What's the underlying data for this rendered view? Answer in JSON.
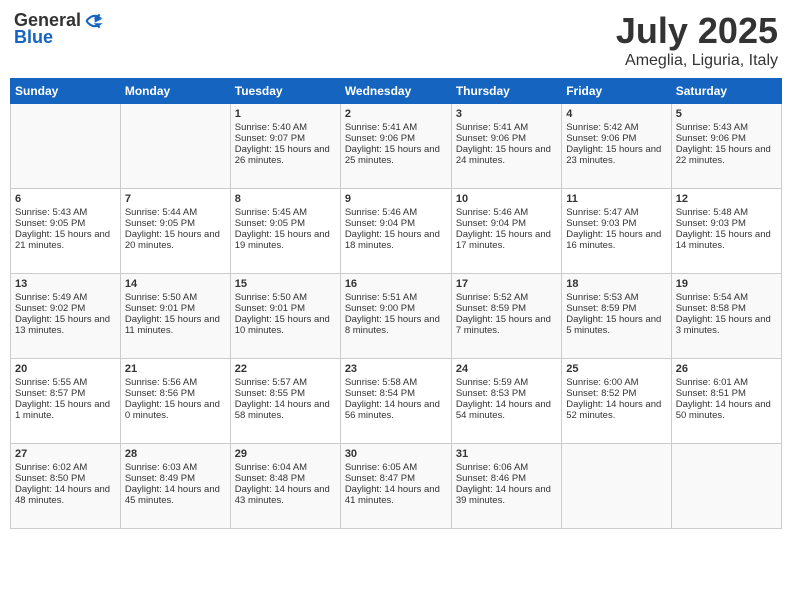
{
  "logo": {
    "general": "General",
    "blue": "Blue"
  },
  "header": {
    "month": "July 2025",
    "location": "Ameglia, Liguria, Italy"
  },
  "weekdays": [
    "Sunday",
    "Monday",
    "Tuesday",
    "Wednesday",
    "Thursday",
    "Friday",
    "Saturday"
  ],
  "weeks": [
    [
      {
        "day": "",
        "sunrise": "",
        "sunset": "",
        "daylight": ""
      },
      {
        "day": "",
        "sunrise": "",
        "sunset": "",
        "daylight": ""
      },
      {
        "day": "1",
        "sunrise": "Sunrise: 5:40 AM",
        "sunset": "Sunset: 9:07 PM",
        "daylight": "Daylight: 15 hours and 26 minutes."
      },
      {
        "day": "2",
        "sunrise": "Sunrise: 5:41 AM",
        "sunset": "Sunset: 9:06 PM",
        "daylight": "Daylight: 15 hours and 25 minutes."
      },
      {
        "day": "3",
        "sunrise": "Sunrise: 5:41 AM",
        "sunset": "Sunset: 9:06 PM",
        "daylight": "Daylight: 15 hours and 24 minutes."
      },
      {
        "day": "4",
        "sunrise": "Sunrise: 5:42 AM",
        "sunset": "Sunset: 9:06 PM",
        "daylight": "Daylight: 15 hours and 23 minutes."
      },
      {
        "day": "5",
        "sunrise": "Sunrise: 5:43 AM",
        "sunset": "Sunset: 9:06 PM",
        "daylight": "Daylight: 15 hours and 22 minutes."
      }
    ],
    [
      {
        "day": "6",
        "sunrise": "Sunrise: 5:43 AM",
        "sunset": "Sunset: 9:05 PM",
        "daylight": "Daylight: 15 hours and 21 minutes."
      },
      {
        "day": "7",
        "sunrise": "Sunrise: 5:44 AM",
        "sunset": "Sunset: 9:05 PM",
        "daylight": "Daylight: 15 hours and 20 minutes."
      },
      {
        "day": "8",
        "sunrise": "Sunrise: 5:45 AM",
        "sunset": "Sunset: 9:05 PM",
        "daylight": "Daylight: 15 hours and 19 minutes."
      },
      {
        "day": "9",
        "sunrise": "Sunrise: 5:46 AM",
        "sunset": "Sunset: 9:04 PM",
        "daylight": "Daylight: 15 hours and 18 minutes."
      },
      {
        "day": "10",
        "sunrise": "Sunrise: 5:46 AM",
        "sunset": "Sunset: 9:04 PM",
        "daylight": "Daylight: 15 hours and 17 minutes."
      },
      {
        "day": "11",
        "sunrise": "Sunrise: 5:47 AM",
        "sunset": "Sunset: 9:03 PM",
        "daylight": "Daylight: 15 hours and 16 minutes."
      },
      {
        "day": "12",
        "sunrise": "Sunrise: 5:48 AM",
        "sunset": "Sunset: 9:03 PM",
        "daylight": "Daylight: 15 hours and 14 minutes."
      }
    ],
    [
      {
        "day": "13",
        "sunrise": "Sunrise: 5:49 AM",
        "sunset": "Sunset: 9:02 PM",
        "daylight": "Daylight: 15 hours and 13 minutes."
      },
      {
        "day": "14",
        "sunrise": "Sunrise: 5:50 AM",
        "sunset": "Sunset: 9:01 PM",
        "daylight": "Daylight: 15 hours and 11 minutes."
      },
      {
        "day": "15",
        "sunrise": "Sunrise: 5:50 AM",
        "sunset": "Sunset: 9:01 PM",
        "daylight": "Daylight: 15 hours and 10 minutes."
      },
      {
        "day": "16",
        "sunrise": "Sunrise: 5:51 AM",
        "sunset": "Sunset: 9:00 PM",
        "daylight": "Daylight: 15 hours and 8 minutes."
      },
      {
        "day": "17",
        "sunrise": "Sunrise: 5:52 AM",
        "sunset": "Sunset: 8:59 PM",
        "daylight": "Daylight: 15 hours and 7 minutes."
      },
      {
        "day": "18",
        "sunrise": "Sunrise: 5:53 AM",
        "sunset": "Sunset: 8:59 PM",
        "daylight": "Daylight: 15 hours and 5 minutes."
      },
      {
        "day": "19",
        "sunrise": "Sunrise: 5:54 AM",
        "sunset": "Sunset: 8:58 PM",
        "daylight": "Daylight: 15 hours and 3 minutes."
      }
    ],
    [
      {
        "day": "20",
        "sunrise": "Sunrise: 5:55 AM",
        "sunset": "Sunset: 8:57 PM",
        "daylight": "Daylight: 15 hours and 1 minute."
      },
      {
        "day": "21",
        "sunrise": "Sunrise: 5:56 AM",
        "sunset": "Sunset: 8:56 PM",
        "daylight": "Daylight: 15 hours and 0 minutes."
      },
      {
        "day": "22",
        "sunrise": "Sunrise: 5:57 AM",
        "sunset": "Sunset: 8:55 PM",
        "daylight": "Daylight: 14 hours and 58 minutes."
      },
      {
        "day": "23",
        "sunrise": "Sunrise: 5:58 AM",
        "sunset": "Sunset: 8:54 PM",
        "daylight": "Daylight: 14 hours and 56 minutes."
      },
      {
        "day": "24",
        "sunrise": "Sunrise: 5:59 AM",
        "sunset": "Sunset: 8:53 PM",
        "daylight": "Daylight: 14 hours and 54 minutes."
      },
      {
        "day": "25",
        "sunrise": "Sunrise: 6:00 AM",
        "sunset": "Sunset: 8:52 PM",
        "daylight": "Daylight: 14 hours and 52 minutes."
      },
      {
        "day": "26",
        "sunrise": "Sunrise: 6:01 AM",
        "sunset": "Sunset: 8:51 PM",
        "daylight": "Daylight: 14 hours and 50 minutes."
      }
    ],
    [
      {
        "day": "27",
        "sunrise": "Sunrise: 6:02 AM",
        "sunset": "Sunset: 8:50 PM",
        "daylight": "Daylight: 14 hours and 48 minutes."
      },
      {
        "day": "28",
        "sunrise": "Sunrise: 6:03 AM",
        "sunset": "Sunset: 8:49 PM",
        "daylight": "Daylight: 14 hours and 45 minutes."
      },
      {
        "day": "29",
        "sunrise": "Sunrise: 6:04 AM",
        "sunset": "Sunset: 8:48 PM",
        "daylight": "Daylight: 14 hours and 43 minutes."
      },
      {
        "day": "30",
        "sunrise": "Sunrise: 6:05 AM",
        "sunset": "Sunset: 8:47 PM",
        "daylight": "Daylight: 14 hours and 41 minutes."
      },
      {
        "day": "31",
        "sunrise": "Sunrise: 6:06 AM",
        "sunset": "Sunset: 8:46 PM",
        "daylight": "Daylight: 14 hours and 39 minutes."
      },
      {
        "day": "",
        "sunrise": "",
        "sunset": "",
        "daylight": ""
      },
      {
        "day": "",
        "sunrise": "",
        "sunset": "",
        "daylight": ""
      }
    ]
  ]
}
